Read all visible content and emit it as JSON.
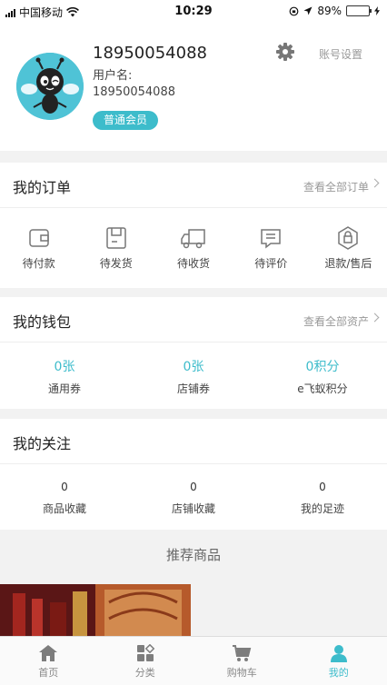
{
  "status_bar": {
    "carrier": "中国移动",
    "time": "10:29",
    "battery": "89%",
    "battery_level": 0.89
  },
  "profile": {
    "phone": "18950054088",
    "username_label": "用户名:",
    "username_value": "18950054088",
    "member_badge": "普通会员",
    "settings_label": "账号设置"
  },
  "orders": {
    "title": "我的订单",
    "view_all": "查看全部订单",
    "items": [
      {
        "label": "待付款",
        "icon": "wallet-icon"
      },
      {
        "label": "待发货",
        "icon": "package-icon"
      },
      {
        "label": "待收货",
        "icon": "truck-icon"
      },
      {
        "label": "待评价",
        "icon": "comment-icon"
      },
      {
        "label": "退款/售后",
        "icon": "refund-icon"
      }
    ]
  },
  "wallet": {
    "title": "我的钱包",
    "view_all": "查看全部资产",
    "items": [
      {
        "value": "0张",
        "label": "通用券"
      },
      {
        "value": "0张",
        "label": "店铺券"
      },
      {
        "value": "0积分",
        "label": "e飞蚁积分"
      }
    ]
  },
  "follows": {
    "title": "我的关注",
    "items": [
      {
        "value": "0",
        "label": "商品收藏"
      },
      {
        "value": "0",
        "label": "店铺收藏"
      },
      {
        "value": "0",
        "label": "我的足迹"
      }
    ]
  },
  "recommend": {
    "title": "推荐商品"
  },
  "tabbar": {
    "items": [
      {
        "label": "首页",
        "icon": "home-icon",
        "active": false
      },
      {
        "label": "分类",
        "icon": "category-icon",
        "active": false
      },
      {
        "label": "购物车",
        "icon": "cart-icon",
        "active": false
      },
      {
        "label": "我的",
        "icon": "user-icon",
        "active": true
      }
    ]
  },
  "colors": {
    "accent": "#3dbccb",
    "text": "#333333",
    "muted": "#999999"
  }
}
